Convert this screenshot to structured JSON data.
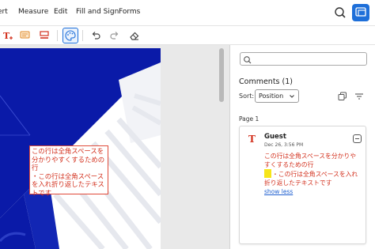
{
  "menubar": {
    "items": [
      "ert",
      "Measure",
      "Edit",
      "Fill and Sign",
      "Forms"
    ],
    "search_icon": "search-icon",
    "panel_icon": "comments-panel-icon"
  },
  "toolbar": {
    "tools": [
      "text-tool",
      "comment-tool",
      "highlight-tool",
      "palette-tool",
      "undo",
      "redo",
      "eraser"
    ]
  },
  "document": {
    "textbox_lines": [
      "この行は全角スペースを",
      "分かりやすくするための",
      "行",
      "・この行は全角スペース",
      "を入れ折り返したテキス",
      "トです"
    ]
  },
  "panel": {
    "search_placeholder": "",
    "title": "Comments (1)",
    "sort_label": "Sort:",
    "sort_value": "Position",
    "page_label": "Page 1",
    "comment": {
      "author": "Guest",
      "date": "Dec 26, 3:56 PM",
      "lines": [
        "この行は全角スペースを分かりや",
        "すくするための行",
        "・この行は全角スペースを入れ",
        "折り返したテキストです"
      ],
      "show_less": "show less"
    }
  },
  "colors": {
    "accent": "#1e6fd9",
    "doc_blue": "#0a1aa8",
    "comment_red": "#d3321f",
    "highlight_yellow": "#f6e51a"
  }
}
